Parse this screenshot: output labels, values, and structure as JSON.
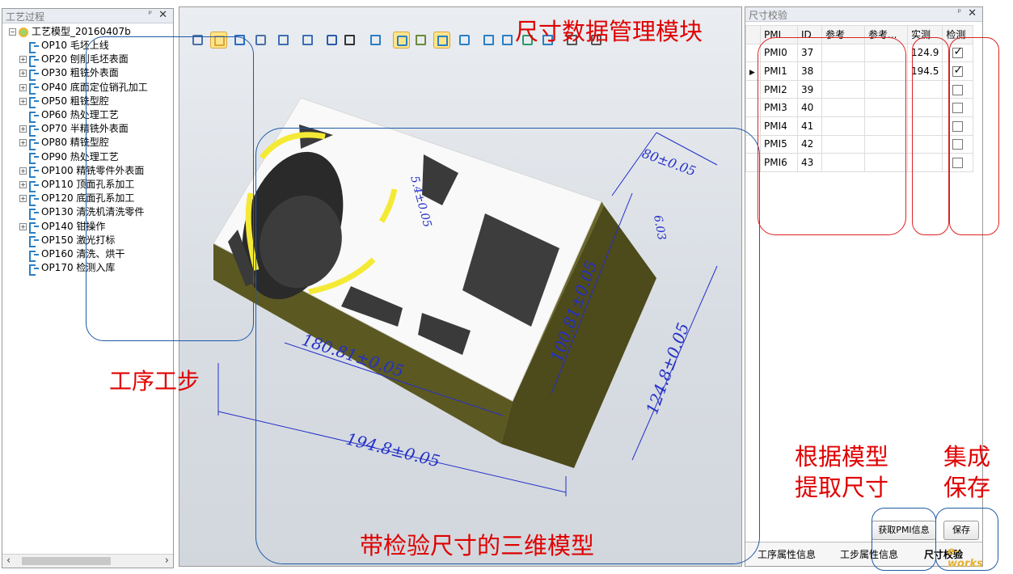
{
  "left_panel": {
    "title": "工艺过程",
    "root": "工艺模型_20160407b",
    "items": [
      {
        "label": "OP10 毛坯上线",
        "expandable": false
      },
      {
        "label": "OP20 刨削毛坯表面",
        "expandable": true
      },
      {
        "label": "OP30 粗铣外表面",
        "expandable": true
      },
      {
        "label": "OP40 底面定位销孔加工",
        "expandable": true
      },
      {
        "label": "OP50 粗铣型腔",
        "expandable": true
      },
      {
        "label": "OP60 热处理工艺",
        "expandable": false
      },
      {
        "label": "OP70 半精铣外表面",
        "expandable": true
      },
      {
        "label": "OP80 精铣型腔",
        "expandable": true
      },
      {
        "label": "OP90 热处理工艺",
        "expandable": false
      },
      {
        "label": "OP100 精铣零件外表面",
        "expandable": true
      },
      {
        "label": "OP110 顶面孔系加工",
        "expandable": true
      },
      {
        "label": "OP120 底面孔系加工",
        "expandable": true
      },
      {
        "label": "OP130 清洗机清洗零件",
        "expandable": false
      },
      {
        "label": "OP140 钳操作",
        "expandable": true
      },
      {
        "label": "OP150 激光打标",
        "expandable": false
      },
      {
        "label": "OP160 清洗、烘干",
        "expandable": false
      },
      {
        "label": "OP170 检测入库",
        "expandable": false
      }
    ]
  },
  "right_panel": {
    "title": "尺寸校验",
    "columns": [
      "PMI",
      "ID",
      "参考",
      "参考...",
      "实测",
      "检测"
    ],
    "rows": [
      {
        "pmi": "PMI0",
        "id": "37",
        "ref": "",
        "ref2": "",
        "actual": "124.9",
        "checked": true
      },
      {
        "pmi": "PMI1",
        "id": "38",
        "ref": "",
        "ref2": "",
        "actual": "194.5",
        "checked": true
      },
      {
        "pmi": "PMI2",
        "id": "39",
        "ref": "",
        "ref2": "",
        "actual": "",
        "checked": false
      },
      {
        "pmi": "PMI3",
        "id": "40",
        "ref": "",
        "ref2": "",
        "actual": "",
        "checked": false
      },
      {
        "pmi": "PMI4",
        "id": "41",
        "ref": "",
        "ref2": "",
        "actual": "",
        "checked": false
      },
      {
        "pmi": "PMI5",
        "id": "42",
        "ref": "",
        "ref2": "",
        "actual": "",
        "checked": false
      },
      {
        "pmi": "PMI6",
        "id": "43",
        "ref": "",
        "ref2": "",
        "actual": "",
        "checked": false
      }
    ],
    "buttons": {
      "get_pmi": "获取PMI信息",
      "save": "保存"
    },
    "tabs": [
      "工序属性信息",
      "工步属性信息",
      "尺寸校验"
    ],
    "watermark": "e-works"
  },
  "model": {
    "dims": [
      "180.81±0.05",
      "194.8±0.05",
      "100.81±0.05",
      "124.8±0.05",
      "80±0.05",
      "6.03",
      "5.4±0.05"
    ]
  },
  "annotations": {
    "pmi_module": "尺寸数据管理模块",
    "process_steps": "工序工步",
    "model_with_dims": "带检验尺寸的三维模型",
    "extract_line1": "根据模型",
    "extract_line2": "提取尺寸",
    "save_line1": "集成",
    "save_line2": "保存"
  },
  "colors": {
    "annotation_red": "#e00000",
    "annotation_blue": "#1f5aa6",
    "dimension_blue": "#2430c8",
    "model_olive": "#5e5a22",
    "highlight_yellow": "#f4ea35"
  }
}
